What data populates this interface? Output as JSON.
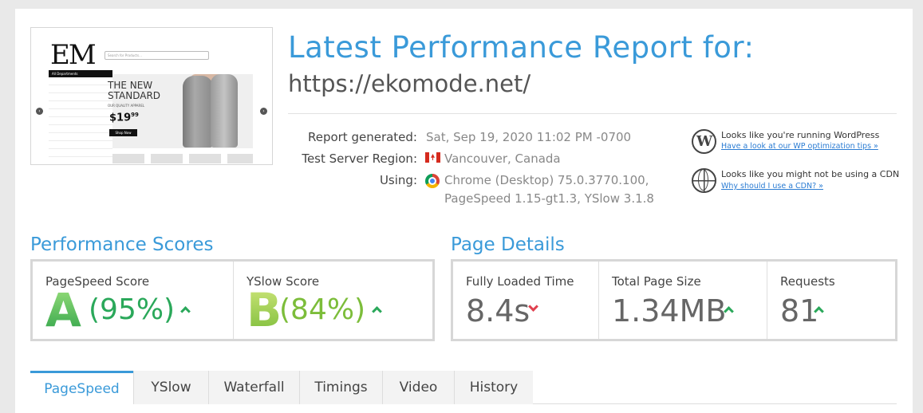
{
  "thumbnail": {
    "logo": "EM",
    "search_placeholder": "Search for Products...",
    "categories_label": "All Departments",
    "hero_title": "THE NEW\nSTANDARD",
    "hero_subtitle": "OUR QUALITY APPAREL",
    "hero_price": "$19",
    "hero_price_cents": "99",
    "hero_button": "Shop Now"
  },
  "header": {
    "title": "Latest Performance Report for:",
    "url": "https://ekomode.net/"
  },
  "meta": {
    "report_generated_label": "Report generated:",
    "report_generated_value": "Sat, Sep 19, 2020 11:02 PM -0700",
    "region_label": "Test Server Region:",
    "region_value": "Vancouver, Canada",
    "using_label": "Using:",
    "using_value_line1": "Chrome (Desktop) 75.0.3770.100,",
    "using_value_line2": "PageSpeed 1.15-gt1.3, YSlow 3.1.8"
  },
  "tips": [
    {
      "icon": "wordpress-icon",
      "text": "Looks like you're running WordPress",
      "link": "Have a look at our WP optimization tips »"
    },
    {
      "icon": "globe-icon",
      "text": "Looks like you might not be using a CDN",
      "link": "Why should I use a CDN? »"
    }
  ],
  "performance": {
    "title": "Performance Scores",
    "pagespeed": {
      "label": "PageSpeed Score",
      "grade": "A",
      "percent": "(95%)",
      "trend": "up",
      "color": "#2aa85a"
    },
    "yslow": {
      "label": "YSlow Score",
      "grade": "B",
      "percent": "(84%)",
      "trend": "up",
      "color": "#7cbd3a"
    }
  },
  "details": {
    "title": "Page Details",
    "fully_loaded": {
      "label": "Fully Loaded Time",
      "value": "8.4s",
      "trend": "down"
    },
    "page_size": {
      "label": "Total Page Size",
      "value": "1.34MB",
      "trend": "up"
    },
    "requests": {
      "label": "Requests",
      "value": "81",
      "trend": "up"
    }
  },
  "tabs": [
    {
      "label": "PageSpeed",
      "active": true
    },
    {
      "label": "YSlow",
      "active": false
    },
    {
      "label": "Waterfall",
      "active": false
    },
    {
      "label": "Timings",
      "active": false
    },
    {
      "label": "Video",
      "active": false
    },
    {
      "label": "History",
      "active": false
    }
  ],
  "colors": {
    "accent": "#3a9ad9",
    "trend_up": "#2aa85a",
    "trend_down": "#e0404f"
  }
}
